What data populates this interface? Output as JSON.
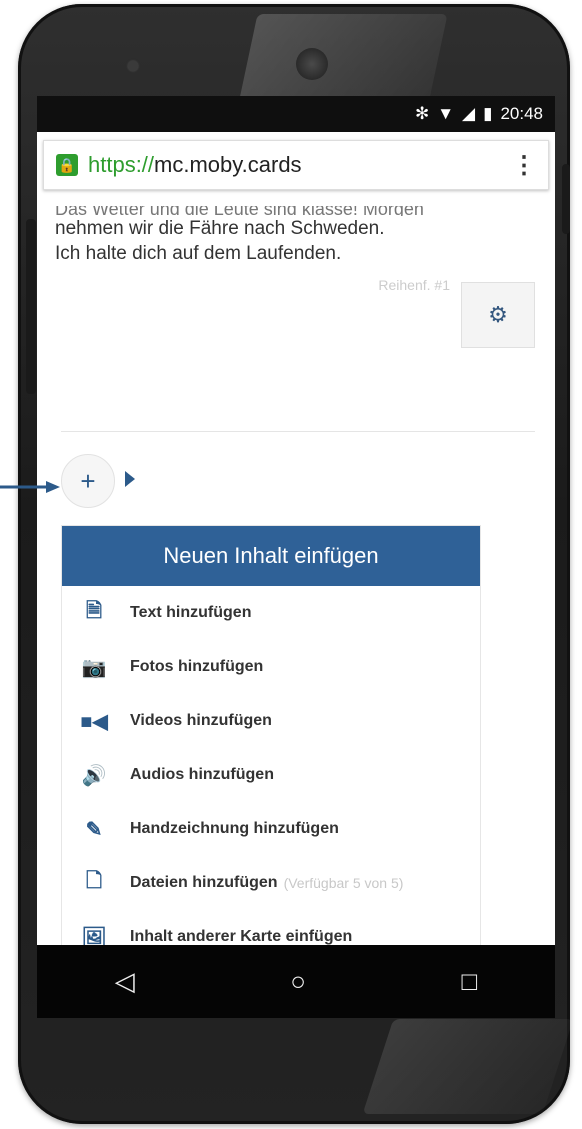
{
  "status": {
    "time": "20:48",
    "icons": [
      "bluetooth-icon",
      "wifi-icon",
      "signal-icon",
      "battery-icon"
    ]
  },
  "browser": {
    "scheme": "https://",
    "host": "mc.moby.cards"
  },
  "card": {
    "cut_line": "Das Wetter und die Leute sind klasse! Morgen",
    "line1": "nehmen wir die Fähre nach Schweden.",
    "line2": "Ich halte dich auf dem Laufenden.",
    "order_label": "Reihenf. #1"
  },
  "panel": {
    "title": "Neuen Inhalt einfügen",
    "items": [
      {
        "icon": "text-file-icon",
        "label": "Text hinzufügen"
      },
      {
        "icon": "camera-icon",
        "label": "Fotos hinzufügen"
      },
      {
        "icon": "video-camera-icon",
        "label": "Videos hinzufügen"
      },
      {
        "icon": "speaker-icon",
        "label": "Audios hinzufügen"
      },
      {
        "icon": "pencil-icon",
        "label": "Handzeichnung hinzufügen"
      },
      {
        "icon": "file-icon",
        "label": "Dateien hinzufügen",
        "note": "(Verfügbar 5 von 5)"
      },
      {
        "icon": "image-icon",
        "label": "Inhalt anderer Karte einfügen"
      }
    ]
  },
  "colors": {
    "accent": "#2f6197",
    "secure": "#2e9d2e"
  }
}
